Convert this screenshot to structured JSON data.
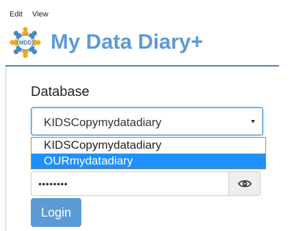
{
  "menubar": {
    "edit_label": "Edit",
    "view_label": "View"
  },
  "header": {
    "title": "My Data Diary+",
    "logo_text": "MDD",
    "logo_icon": "mdd-people-circle-logo"
  },
  "form": {
    "database_label": "Database",
    "database_selected": "KIDSCopymydatadiary",
    "database_options": [
      "KIDSCopymydatadiary",
      "OURmydatadiary"
    ],
    "highlighted_option_index": 1,
    "password_value": "••••••••",
    "show_password_icon": "eye-icon",
    "login_label": "Login"
  },
  "colors": {
    "brand": "#5b9bd5",
    "highlight": "#1e90ff",
    "header_rule": "#4a7fb5"
  }
}
